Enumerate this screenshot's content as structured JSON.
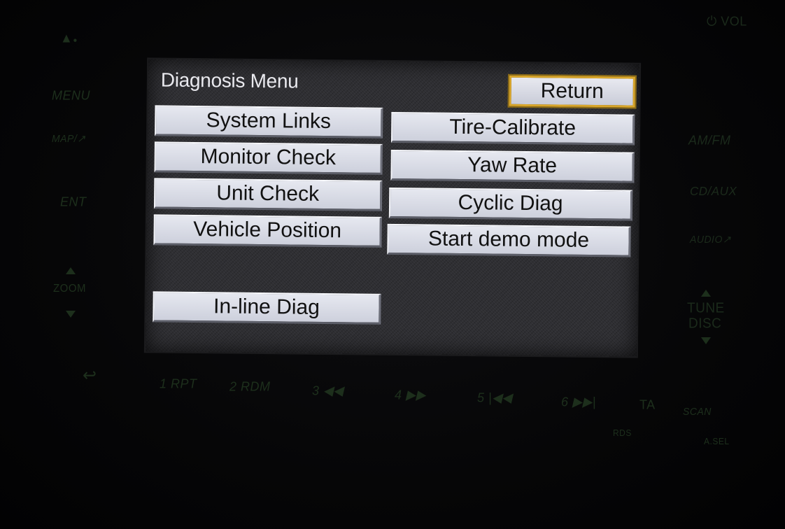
{
  "screen": {
    "title": "Diagnosis Menu",
    "return_label": "Return",
    "left_buttons": [
      "System Links",
      "Monitor Check",
      "Unit Check",
      "Vehicle Position"
    ],
    "right_buttons": [
      "Tire-Calibrate",
      "Yaw Rate",
      "Cyclic Diag",
      "Start demo mode"
    ],
    "inline_diag_label": "In-line Diag"
  },
  "hardware": {
    "vol_label": "⏻ VOL",
    "left": {
      "menu": "MENU",
      "map": "MAP/↗",
      "ent": "ENT",
      "zoom": "ZOOM"
    },
    "right": {
      "am_fm": "AM/FM",
      "cd_aux": "CD/AUX",
      "audio": "AUDIO↗",
      "tune": "TUNE",
      "disc": "DISC"
    },
    "bottom": {
      "back": "↩",
      "preset1": "1 RPT",
      "preset2": "2 RDM",
      "preset3": "3 ◀◀",
      "preset4": "4 ▶▶",
      "preset5": "5 |◀◀",
      "preset6": "6 ▶▶|",
      "ta": "TA",
      "rds": "RDS",
      "scan": "SCAN",
      "asel": "A.SEL"
    }
  },
  "colors": {
    "screen_bg": "#2f2f33",
    "button_face": "#dcdee8",
    "return_highlight": "#d9a62a",
    "silkscreen": "#1d2f1c"
  }
}
